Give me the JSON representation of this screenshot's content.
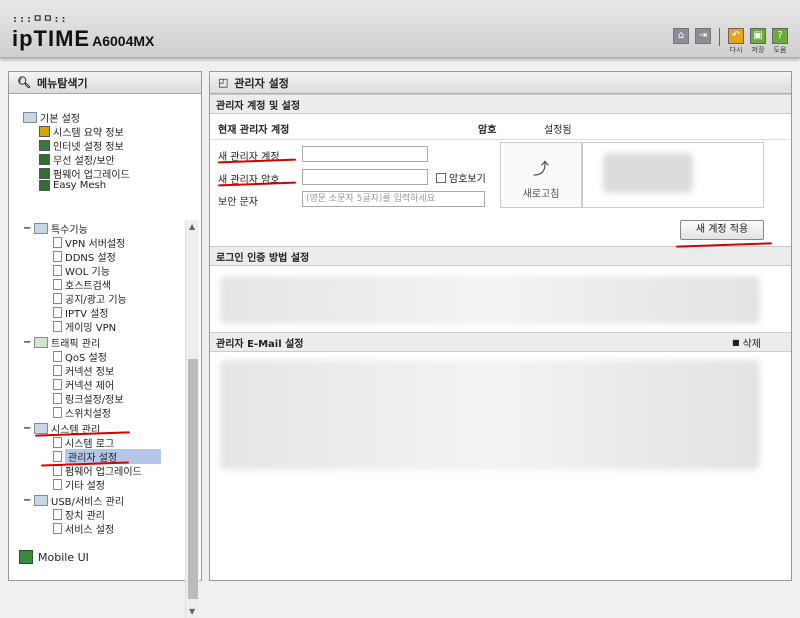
{
  "header": {
    "logo_dots": ":::ㅁㅁ::",
    "brand": "ipTIME",
    "model": "A6004MX",
    "icons": [
      "home-icon",
      "logout-icon"
    ],
    "buttons": [
      {
        "label": "다시",
        "color": "#e8a020",
        "icon": "undo-icon"
      },
      {
        "label": "저장",
        "color": "#6aab3a",
        "icon": "save-icon"
      },
      {
        "label": "도움",
        "color": "#6aab3a",
        "icon": "help-icon"
      }
    ]
  },
  "sidebar": {
    "title": "메뉴탐색기",
    "basic": {
      "label": "기본 설정",
      "items": [
        "시스템 요약 정보",
        "인터넷 설정 정보",
        "무선 설정/보안",
        "펌웨어 업그레이드",
        "Easy Mesh"
      ]
    },
    "special": {
      "label": "특수기능",
      "items": [
        "VPN 서버설정",
        "DDNS 설정",
        "WOL 기능",
        "호스트검색",
        "공지/광고 기능",
        "IPTV 설정",
        "게이밍 VPN"
      ]
    },
    "traffic": {
      "label": "트래픽 관리",
      "items": [
        "QoS 설정",
        "커넥션 정보",
        "커넥션 제어",
        "링크설정/정보",
        "스위치설정"
      ]
    },
    "system": {
      "label": "시스템 관리",
      "items": [
        "시스템 로그",
        "관리자 설정",
        "펌웨어 업그레이드",
        "기타 설정"
      ]
    },
    "usb": {
      "label": "USB/서비스 관리",
      "items": [
        "장치 관리",
        "서비스 설정"
      ]
    },
    "mobile": "Mobile UI"
  },
  "main": {
    "title": "관리자 설정",
    "account_section": "관리자 계정 및 설정",
    "current_label": "현재 관리자 계정",
    "password_label": "암호",
    "password_status": "설정됨",
    "new_id_label": "새 관리자 계정",
    "new_pw_label": "새 관리자 암호",
    "show_pw_label": "암호보기",
    "captcha_label": "보안 문자",
    "captcha_placeholder": "(영문 소문자 5글자)를 입력하세요",
    "refresh_label": "새로고침",
    "apply_label": "새 계정 적용",
    "login_section": "로그인 인증 방법 설정",
    "email_section": "관리자 E-Mail 설정",
    "delete_label": "삭제"
  }
}
